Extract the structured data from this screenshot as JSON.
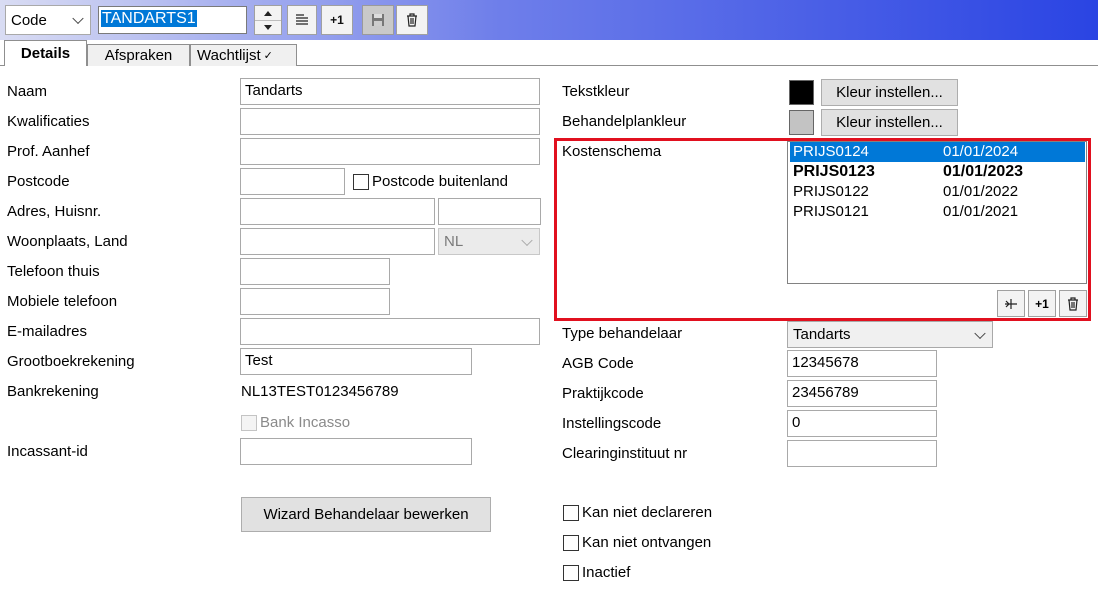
{
  "toolbar": {
    "field_select": "Code",
    "code_value": "TANDARTS1",
    "plus_one_label": "+1"
  },
  "tabs": [
    {
      "label": "Details"
    },
    {
      "label": "Afspraken"
    },
    {
      "label": "Wachtlijst"
    }
  ],
  "left": {
    "naam": {
      "label": "Naam",
      "value": "Tandarts"
    },
    "kwalificaties": {
      "label": "Kwalificaties",
      "value": ""
    },
    "aanhef": {
      "label": "Prof. Aanhef",
      "value": ""
    },
    "postcode": {
      "label": "Postcode",
      "value": "",
      "buitenland_label": "Postcode buitenland"
    },
    "adres": {
      "label": "Adres, Huisnr.",
      "street": "",
      "number": ""
    },
    "woonplaats": {
      "label": "Woonplaats, Land",
      "city": "",
      "country": "NL"
    },
    "telefoon": {
      "label": "Telefoon thuis",
      "value": ""
    },
    "mobiel": {
      "label": "Mobiele telefoon",
      "value": ""
    },
    "email": {
      "label": "E-mailadres",
      "value": ""
    },
    "grootboek": {
      "label": "Grootboekrekening",
      "value": "Test"
    },
    "bank": {
      "label": "Bankrekening",
      "value": "NL13TEST0123456789"
    },
    "incasso_label": "Bank Incasso",
    "incassant": {
      "label": "Incassant-id",
      "value": ""
    },
    "wizard_label": "Wizard Behandelaar bewerken"
  },
  "right": {
    "tekstkleur": {
      "label": "Tekstkleur",
      "color": "#000000",
      "button": "Kleur instellen..."
    },
    "plankleur": {
      "label": "Behandelplankleur",
      "color": "#c3c3c3",
      "button": "Kleur instellen..."
    },
    "kostenschema": {
      "label": "Kostenschema",
      "items": [
        {
          "code": "PRIJS0124",
          "date": "01/01/2024",
          "selected": true,
          "bold": false
        },
        {
          "code": "PRIJS0123",
          "date": "01/01/2023",
          "selected": false,
          "bold": true
        },
        {
          "code": "PRIJS0122",
          "date": "01/01/2022",
          "selected": false,
          "bold": false
        },
        {
          "code": "PRIJS0121",
          "date": "01/01/2021",
          "selected": false,
          "bold": false
        }
      ],
      "add_label": "+1"
    },
    "type": {
      "label": "Type behandelaar",
      "value": "Tandarts"
    },
    "agb": {
      "label": "AGB Code",
      "value": "12345678"
    },
    "praktijk": {
      "label": "Praktijkcode",
      "value": "23456789"
    },
    "instelling": {
      "label": "Instellingscode",
      "value": "0"
    },
    "clearing": {
      "label": "Clearinginstituut nr",
      "value": ""
    },
    "checks": [
      "Kan niet declareren",
      "Kan niet ontvangen",
      "Inactief"
    ]
  },
  "colors": {
    "accent": "#0078d7",
    "highlight_border": "#e1101f"
  }
}
